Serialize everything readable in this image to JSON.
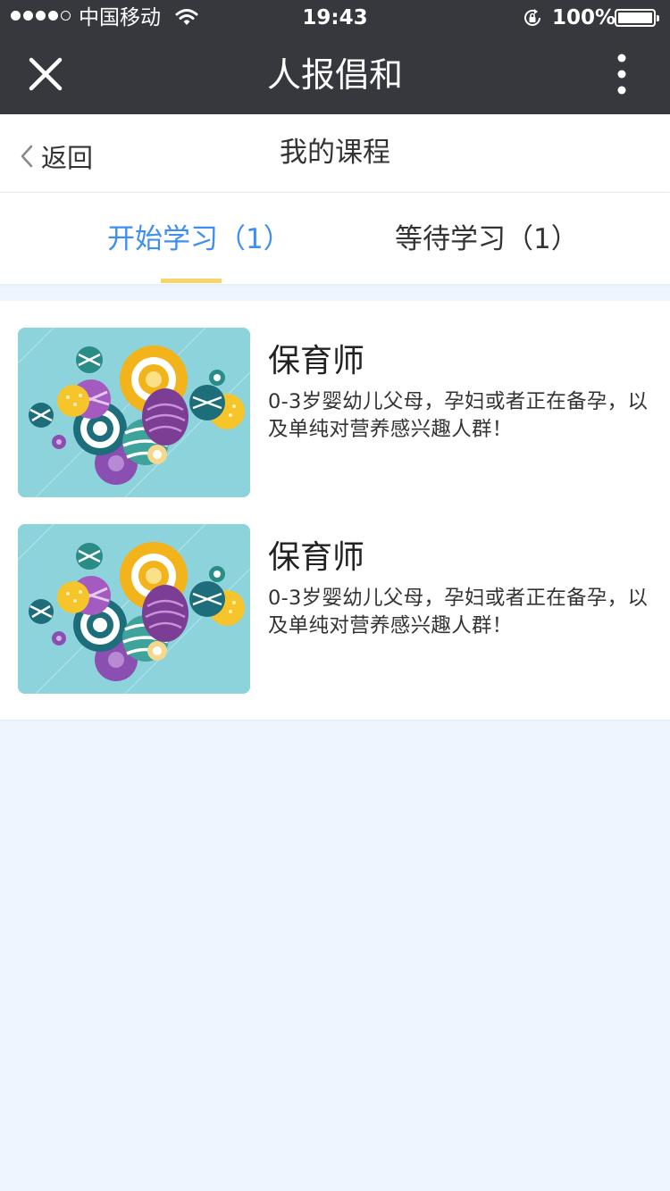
{
  "status_bar": {
    "carrier": "中国移动",
    "time": "19:43",
    "battery": "100%",
    "battery_level": 1.0,
    "signal_bars": 4,
    "signal_total": 5
  },
  "app_bar": {
    "title": "人报倡和",
    "close_icon": "close-icon",
    "more_icon": "more-vertical-icon"
  },
  "header": {
    "back_label": "返回",
    "title": "我的课程"
  },
  "tabs": [
    {
      "label": "开始学习（1）",
      "active": true
    },
    {
      "label": "等待学习（1）",
      "active": false
    }
  ],
  "courses": [
    {
      "name": "保育师",
      "description": "0-3岁婴幼儿父母，孕妇或者正在备孕，以及单纯对营养感兴趣人群！"
    },
    {
      "name": "保育师",
      "description": "0-3岁婴幼儿父母，孕妇或者正在备孕，以及单纯对营养感兴趣人群！"
    }
  ],
  "colors": {
    "topbar": "#37383d",
    "accent": "#3d8ff0",
    "underline": "#f7d36a",
    "page_bg": "#eef5fe"
  }
}
